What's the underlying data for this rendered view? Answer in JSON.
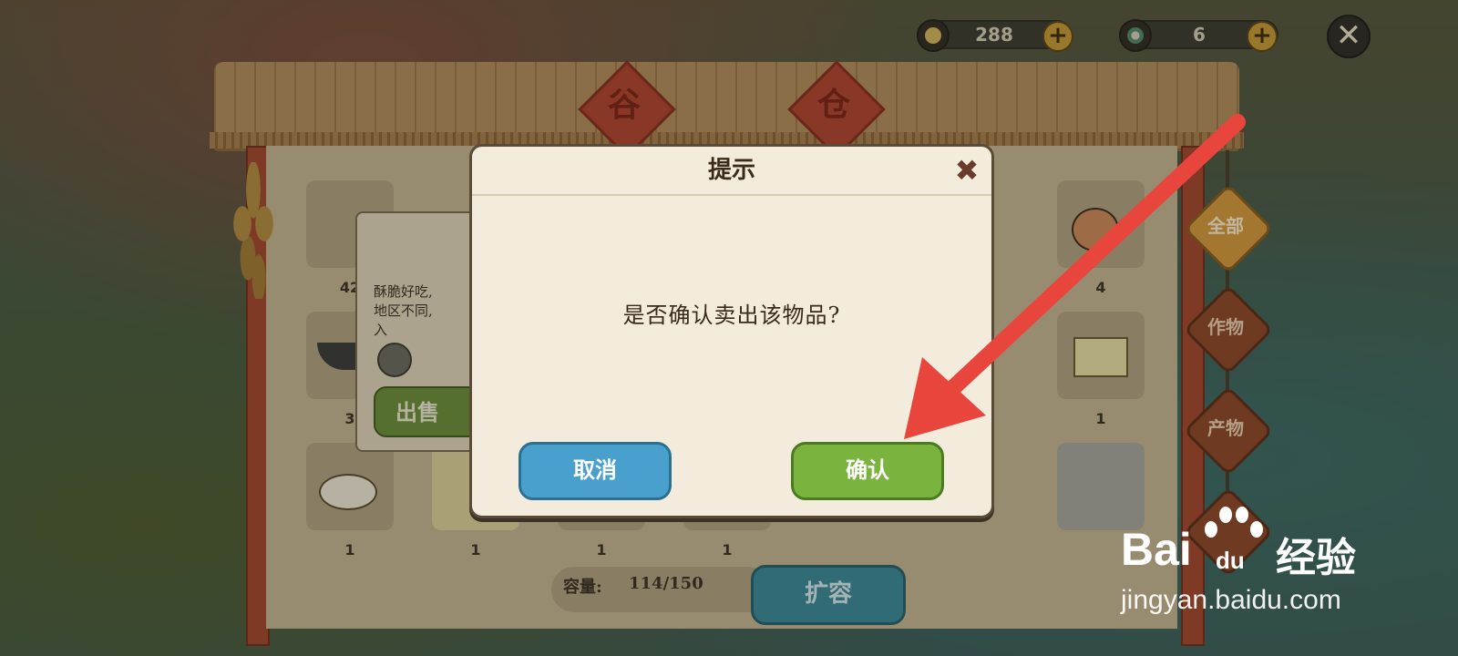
{
  "currency": {
    "coins": "288",
    "gems": "6"
  },
  "granary_sign": [
    "谷",
    "仓"
  ],
  "side_tabs": [
    {
      "label": "全部",
      "active": true
    },
    {
      "label": "作物",
      "active": false
    },
    {
      "label": "产物",
      "active": false
    }
  ],
  "grid_counts": {
    "r1c1": "42",
    "r1c7": "4",
    "r2c1": "3",
    "r2c7": "1",
    "r3c1": "1",
    "r3c2": "1",
    "r3c3": "1",
    "r3c4": "1"
  },
  "item_popup": {
    "description": "酥脆好吃,\n地区不同,\n入",
    "sell_label": "出售"
  },
  "capacity": {
    "label": "容量:",
    "value": "114/150",
    "expand_label": "扩容"
  },
  "dialog": {
    "title": "提示",
    "message": "是否确认卖出该物品?",
    "cancel_label": "取消",
    "confirm_label": "确认"
  },
  "watermark": {
    "brand_latin": "Bai",
    "brand_du": "du",
    "brand_cn": "经验",
    "url": "jingyan.baidu.com"
  },
  "colors": {
    "cancel": "#4aa0cc",
    "confirm": "#7bb33f",
    "arrow": "#e8453c"
  }
}
